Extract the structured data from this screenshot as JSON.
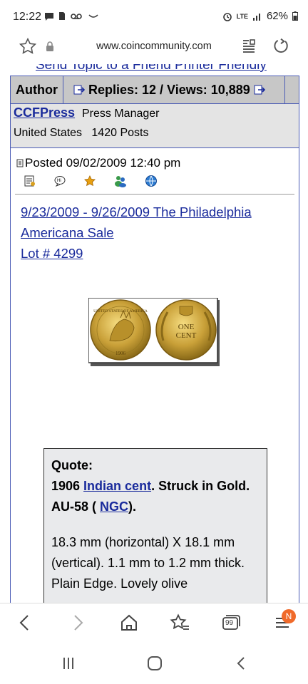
{
  "status": {
    "time": "12:22",
    "signal": "LTE",
    "battery": "62%"
  },
  "browser": {
    "url": "www.coincommunity.com"
  },
  "topcut": {
    "text": "Send Topic to a Friend   Printer Friendly"
  },
  "topic": {
    "author_label": "Author",
    "replies_text": "Replies: 12 / Views: 10,889"
  },
  "user": {
    "name": "CCFPress",
    "role": "Press Manager",
    "location": "United States",
    "posts": "1420 Posts"
  },
  "post": {
    "posted": "Posted 09/02/2009  12:40 pm",
    "title_line1": "9/23/2009 - 9/26/2009 The Philadelphia",
    "title_line2": "Americana Sale",
    "title_line3": "Lot # 4299"
  },
  "coin": {
    "obverse_text": "UNITED STATES OF AMERICA",
    "obverse_year": "1906",
    "reverse_text1": "ONE",
    "reverse_text2": "CENT"
  },
  "quote": {
    "label": "Quote:",
    "line1_pre": "1906 ",
    "line1_link": "Indian cent",
    "line1_post": ". Struck in Gold.",
    "line2_pre": "AU-58 ( ",
    "line2_link": "NGC",
    "line2_post": ").",
    "body": "18.3 mm (horizontal) X 18.1 mm (vertical). 1.1 mm to 1.2 mm thick. Plain Edge. Lovely olive"
  },
  "bottomnav": {
    "badge": "N",
    "tabs_count": "99"
  },
  "colors": {
    "link": "#1a2b9c",
    "header_bg": "#c7c7c7",
    "border": "#4a5bb5",
    "gold": "#c9a038"
  }
}
